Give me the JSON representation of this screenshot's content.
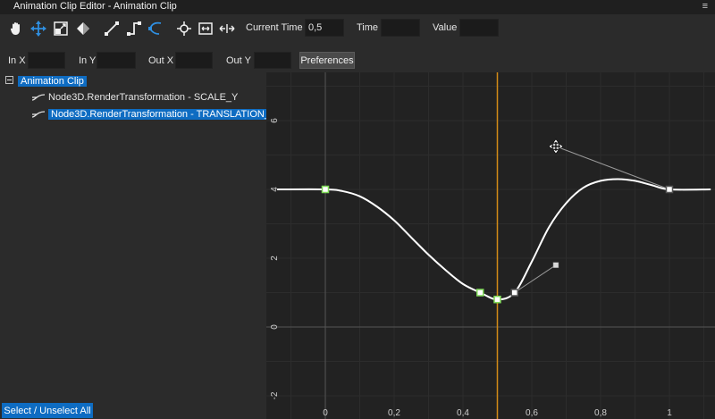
{
  "window": {
    "title": "Animation Clip Editor - Animation Clip",
    "menu_glyph": "≡"
  },
  "toolbar": {
    "tools": [
      {
        "name": "pan-hand-icon"
      },
      {
        "name": "move-arrows-icon",
        "active": true
      },
      {
        "name": "scale-box-icon"
      },
      {
        "name": "diamond-key-icon"
      },
      {
        "name": "linear-interpolation-icon"
      },
      {
        "name": "step-interpolation-icon"
      },
      {
        "name": "bezier-interpolation-icon",
        "active": true
      },
      {
        "name": "center-view-icon"
      },
      {
        "name": "fit-view-icon"
      },
      {
        "name": "fit-horizontal-icon"
      }
    ],
    "current_time_label": "Current Time",
    "current_time_value": "0,5",
    "time_label": "Time",
    "time_value": "",
    "value_label": "Value",
    "value_value": ""
  },
  "properties": {
    "in_x_label": "In X",
    "in_x_value": "",
    "in_y_label": "In Y",
    "in_y_value": "",
    "out_x_label": "Out X",
    "out_x_value": "",
    "out_y_label": "Out Y",
    "out_y_value": "",
    "preferences_label": "Preferences"
  },
  "tree": {
    "root": "Animation Clip",
    "items": [
      {
        "label": "Node3D.RenderTransformation - SCALE_Y",
        "selected": false
      },
      {
        "label": "Node3D.RenderTransformation - TRANSLATION_Y",
        "selected": true
      }
    ]
  },
  "footer": {
    "select_all_label": "Select / Unselect All"
  },
  "graph": {
    "x_ticks": [
      "0",
      "0,2",
      "0,4",
      "0,6",
      "0,8",
      "1"
    ],
    "y_ticks": [
      "-2",
      "0",
      "2",
      "4",
      "6"
    ],
    "current_time": 0.5,
    "colors": {
      "curve": "#ffffff",
      "playhead": "#d28a17",
      "key": "#ffffff",
      "key_selected": "#7ed957",
      "grid": "#2c2c2c",
      "axis": "#555555"
    },
    "keys": [
      {
        "t": 0,
        "v": 4.0,
        "selected": true
      },
      {
        "t": 0.45,
        "v": 1.0,
        "selected": true
      },
      {
        "t": 0.5,
        "v": 0.8,
        "selected": true
      },
      {
        "t": 0.55,
        "v": 1.0,
        "selected": false
      },
      {
        "t": 1.0,
        "v": 4.0,
        "selected": false
      }
    ],
    "tangent_handles": [
      {
        "from_t": 0.55,
        "from_v": 1.0,
        "to_t": 0.67,
        "to_v": 1.8
      },
      {
        "from_t": 1.0,
        "from_v": 4.0,
        "to_t": 0.67,
        "to_v": 5.25
      }
    ],
    "curve_samples": [
      [
        -0.14,
        4.0
      ],
      [
        0.0,
        4.0
      ],
      [
        0.05,
        3.95
      ],
      [
        0.1,
        3.8
      ],
      [
        0.15,
        3.5
      ],
      [
        0.2,
        3.1
      ],
      [
        0.25,
        2.6
      ],
      [
        0.3,
        2.1
      ],
      [
        0.35,
        1.65
      ],
      [
        0.4,
        1.25
      ],
      [
        0.45,
        1.0
      ],
      [
        0.5,
        0.8
      ],
      [
        0.55,
        1.0
      ],
      [
        0.6,
        1.9
      ],
      [
        0.65,
        2.9
      ],
      [
        0.7,
        3.6
      ],
      [
        0.75,
        4.05
      ],
      [
        0.8,
        4.25
      ],
      [
        0.85,
        4.3
      ],
      [
        0.9,
        4.25
      ],
      [
        0.95,
        4.12
      ],
      [
        1.0,
        4.0
      ],
      [
        1.12,
        4.0
      ]
    ]
  }
}
